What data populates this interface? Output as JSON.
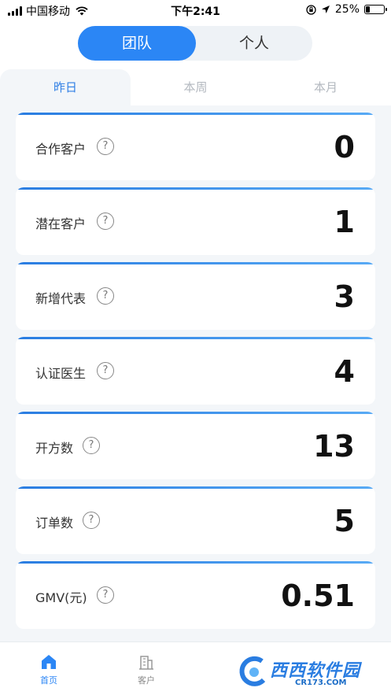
{
  "status_bar": {
    "carrier": "中国移动",
    "time": "下午2:41",
    "battery_level": "25%",
    "battery_fraction": 0.25
  },
  "view_switch": {
    "team": "团队",
    "personal": "个人",
    "selected": "团队"
  },
  "period_tabs": [
    {
      "label": "昨日",
      "active": true
    },
    {
      "label": "本周",
      "active": false
    },
    {
      "label": "本月",
      "active": false
    }
  ],
  "metrics": [
    {
      "label": "合作客户",
      "value": "0"
    },
    {
      "label": "潜在客户",
      "value": "1"
    },
    {
      "label": "新增代表",
      "value": "3"
    },
    {
      "label": "认证医生",
      "value": "4"
    },
    {
      "label": "开方数",
      "value": "13"
    },
    {
      "label": "订单数",
      "value": "5"
    },
    {
      "label": "GMV(元)",
      "value": "0.51"
    }
  ],
  "help_glyph": "?",
  "bottom_nav": [
    {
      "label": "首页",
      "icon": "home-icon",
      "active": true
    },
    {
      "label": "客户",
      "icon": "building-icon",
      "active": false
    }
  ],
  "watermark": {
    "text": "西西软件园",
    "sub": "CR173.COM"
  },
  "colors": {
    "accent": "#2b86f5",
    "tab_active": "#2f7fe5",
    "background": "#f3f6f9"
  }
}
